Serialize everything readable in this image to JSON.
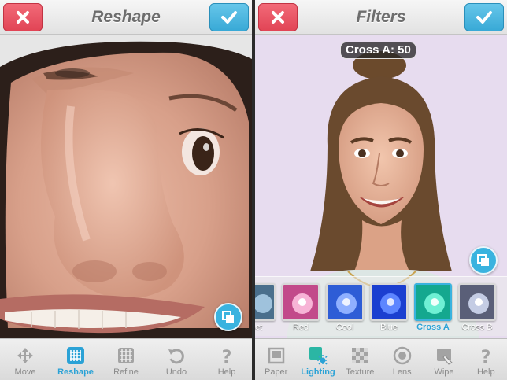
{
  "left_screen": {
    "title": "Reshape",
    "cancel_icon": "close-icon",
    "confirm_icon": "check-icon",
    "toolbar": [
      {
        "label": "Move",
        "icon": "move-arrows-icon",
        "active": false
      },
      {
        "label": "Reshape",
        "icon": "reshape-grid-icon",
        "active": true
      },
      {
        "label": "Refine",
        "icon": "refine-grid-icon",
        "active": false
      },
      {
        "label": "Undo",
        "icon": "undo-icon",
        "active": false
      },
      {
        "label": "Help",
        "icon": "help-icon",
        "active": false
      }
    ]
  },
  "right_screen": {
    "title": "Filters",
    "value_label": "Cross A: 50",
    "filters": [
      {
        "label": "set",
        "color": "#6a8da8"
      },
      {
        "label": "Red",
        "color": "#e86aa7"
      },
      {
        "label": "Cool",
        "color": "#3a6fe8"
      },
      {
        "label": "Blue",
        "color": "#2a55e0"
      },
      {
        "label": "Cross A",
        "color": "#2bd4b4",
        "selected": true
      },
      {
        "label": "Cross B",
        "color": "#b0bcd8"
      }
    ],
    "toolbar": [
      {
        "label": "Paper",
        "icon": "paper-icon",
        "active": false
      },
      {
        "label": "Lighting",
        "icon": "lighting-icon",
        "active": true
      },
      {
        "label": "Texture",
        "icon": "texture-icon",
        "active": false
      },
      {
        "label": "Lens",
        "icon": "lens-icon",
        "active": false
      },
      {
        "label": "Wipe",
        "icon": "wipe-icon",
        "active": false
      },
      {
        "label": "Help",
        "icon": "help-icon",
        "active": false
      }
    ]
  },
  "colors": {
    "accent": "#2ba2d6",
    "cancel": "#e14455",
    "confirm": "#38a9d6",
    "filters_background": "#e7dcef"
  }
}
